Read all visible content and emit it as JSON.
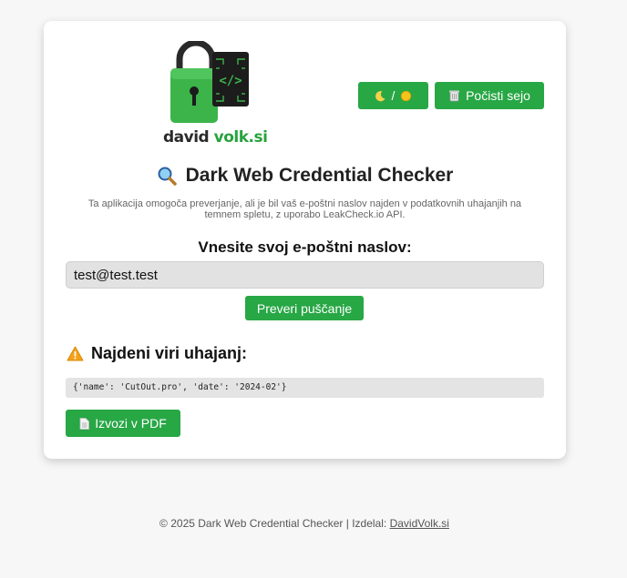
{
  "logo": {
    "text_part1": "david",
    "text_part2": "volk.si",
    "chip_code": "</>",
    "icon": "padlock-and-chip-logo"
  },
  "toolbar": {
    "theme_toggle_label": "/",
    "theme_icons": [
      "moon-icon",
      "sun-icon"
    ],
    "clear_session_label": "Počisti sejo",
    "clear_icon": "trash-icon"
  },
  "main": {
    "title": "Dark Web Credential Checker",
    "title_icon": "magnifier-icon",
    "description": "Ta aplikacija omogoča preverjanje, ali je bil vaš e-poštni naslov najden v podatkovnih uhajanjih na temnem spletu, z uporabo LeakCheck.io API.",
    "email_label": "Vnesite svoj e-poštni naslov:",
    "email_value": "test@test.test",
    "check_button_label": "Preveri puščanje"
  },
  "results": {
    "heading": "Najdeni viri uhajanj:",
    "heading_icon": "warning-icon",
    "entries": [
      "{'name': 'CutOut.pro', 'date': '2024-02'}"
    ],
    "export_button_label": "Izvozi v PDF",
    "export_icon": "document-icon"
  },
  "footer": {
    "text": "© 2025 Dark Web Credential Checker | Izdelal:",
    "link_text": "DavidVolk.si"
  },
  "colors": {
    "accent": "#28a745",
    "card_bg": "#ffffff",
    "page_bg": "#f7f7f7",
    "warning": "#f4a11a"
  }
}
